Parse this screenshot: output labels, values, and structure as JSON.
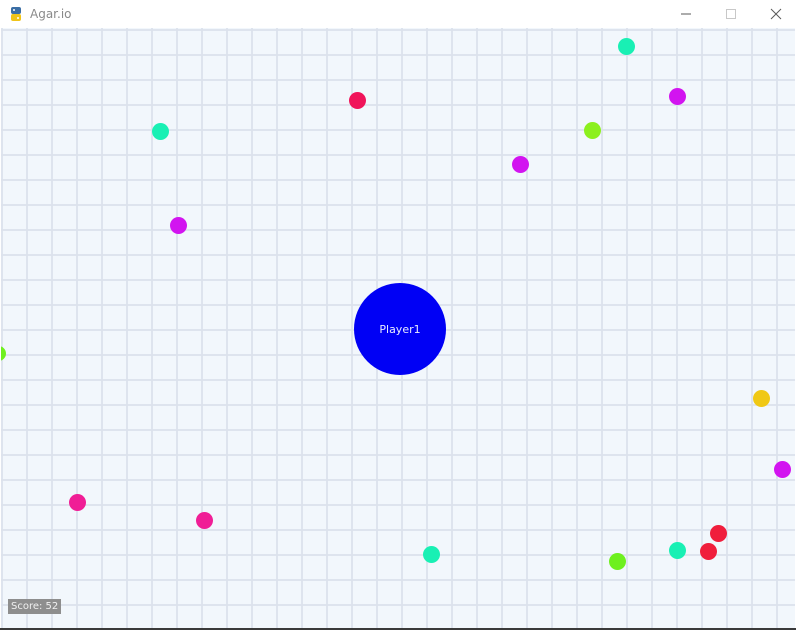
{
  "window": {
    "title": "Agar.io",
    "icon": "python-icon"
  },
  "controls": {
    "minimize_icon": "minimize-icon",
    "maximize_icon": "maximize-icon",
    "close_icon": "close-icon"
  },
  "game": {
    "background": "#f2f7fc",
    "grid_color": "#dce2ec",
    "player": {
      "name": "Player1",
      "color": "#0000f5"
    },
    "score_text": "Score: 52",
    "pellet_colors": [
      "#19f0b4",
      "#f0145a",
      "#d214f0",
      "#8cf01e",
      "#f01e96",
      "#f0c814",
      "#f01e3c",
      "#6ef01e"
    ]
  }
}
